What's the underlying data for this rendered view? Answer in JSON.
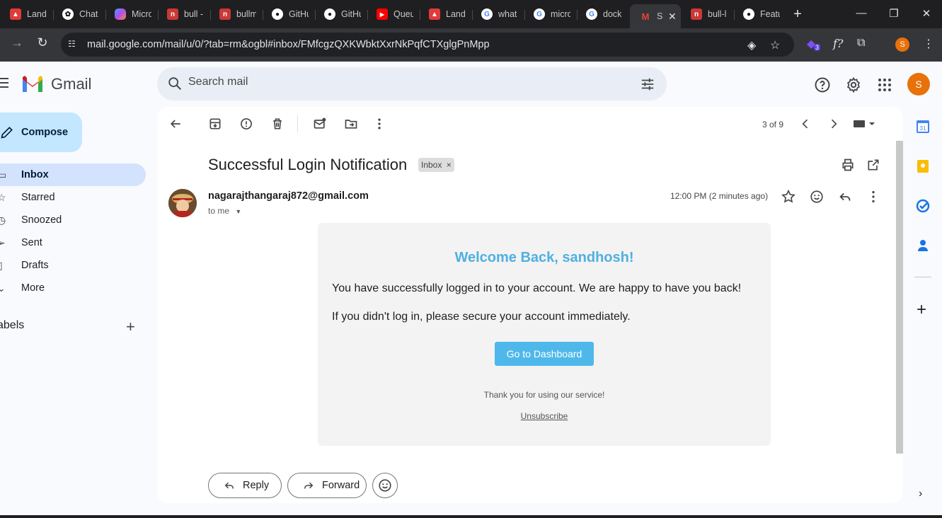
{
  "browser": {
    "tabs": [
      {
        "label": "Land",
        "icon": "pdf-icon",
        "color": "#e23a3a"
      },
      {
        "label": "Chat",
        "icon": "chatgpt-icon",
        "color": "#ffffff"
      },
      {
        "label": "Micro",
        "icon": "copilot-icon",
        "color": "#7a5cf0"
      },
      {
        "label": "bull -",
        "icon": "npm-icon",
        "color": "#cb3837"
      },
      {
        "label": "bullm",
        "icon": "npm-icon",
        "color": "#cb3837"
      },
      {
        "label": "GitHu",
        "icon": "github-icon",
        "color": "#ffffff"
      },
      {
        "label": "GitHu",
        "icon": "github-icon",
        "color": "#ffffff"
      },
      {
        "label": "Queu",
        "icon": "youtube-icon",
        "color": "#ff0000"
      },
      {
        "label": "Land",
        "icon": "pdf-icon",
        "color": "#e23a3a"
      },
      {
        "label": "what",
        "icon": "google-icon",
        "color": "#ffffff"
      },
      {
        "label": "micro",
        "icon": "google-icon",
        "color": "#ffffff"
      },
      {
        "label": "dock",
        "icon": "google-icon",
        "color": "#ffffff"
      },
      {
        "label": "S",
        "icon": "gmail-icon",
        "color": "#ea4335",
        "active": true
      },
      {
        "label": "bull-l",
        "icon": "npm-icon",
        "color": "#cb3837"
      },
      {
        "label": "Featu",
        "icon": "github-icon",
        "color": "#ffffff"
      }
    ],
    "url": "mail.google.com/mail/u/0/?tab=rm&ogbl#inbox/FMfcgzQXKWbktXxrNkPqfCTXglgPnMpp",
    "extension_badge": "3",
    "profile_initial": "S"
  },
  "gmail": {
    "logo_text": "Gmail",
    "search_placeholder": "Search mail",
    "account_initial": "S",
    "compose_label": "Compose",
    "nav": [
      {
        "label": "Inbox",
        "icon": "inbox-icon",
        "active": true
      },
      {
        "label": "Starred",
        "icon": "star-icon"
      },
      {
        "label": "Snoozed",
        "icon": "clock-icon"
      },
      {
        "label": "Sent",
        "icon": "send-icon"
      },
      {
        "label": "Drafts",
        "icon": "draft-icon"
      },
      {
        "label": "More",
        "icon": "chevron-down-icon"
      }
    ],
    "labels_title": "Labels",
    "labels_visible_text": "abels"
  },
  "message": {
    "pager": "3 of 9",
    "subject": "Successful Login Notification",
    "label_chip": "Inbox",
    "sender": "nagarajthangaraj872@gmail.com",
    "recipient_line": "to me",
    "timestamp": "12:00 PM (2 minutes ago)",
    "body": {
      "heading": "Welcome Back, sandhosh!",
      "line1": "You have successfully logged in to your account. We are happy to have you back!",
      "line2": "If you didn't log in, please secure your account immediately.",
      "button": "Go to Dashboard",
      "thanks": "Thank you for using our service!",
      "unsubscribe": "Unsubscribe"
    },
    "reply_label": "Reply",
    "forward_label": "Forward"
  },
  "colors": {
    "accent_blue": "#4fb8ea",
    "welcome_blue": "#4fb0e0",
    "compose_bg": "#c2e7ff",
    "active_nav_bg": "#d3e3fd",
    "avatar_orange": "#e8710a"
  }
}
